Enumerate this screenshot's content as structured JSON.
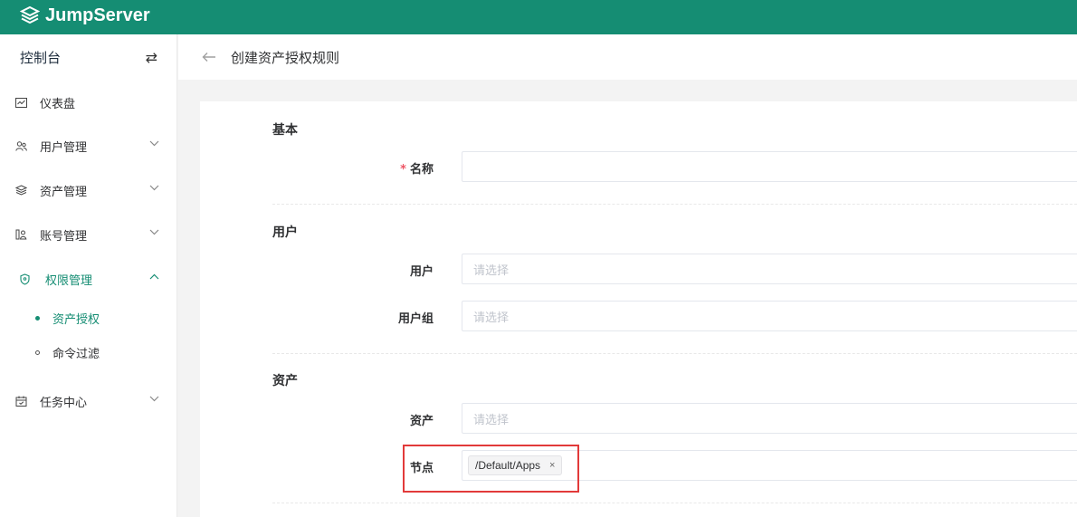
{
  "app": {
    "brand": "JumpServer"
  },
  "sidebar": {
    "title": "控制台",
    "items": [
      {
        "label": "仪表盘",
        "icon": "dashboard-icon"
      },
      {
        "label": "用户管理",
        "icon": "users-icon"
      },
      {
        "label": "资产管理",
        "icon": "layers-icon"
      },
      {
        "label": "账号管理",
        "icon": "accounts-icon"
      },
      {
        "label": "权限管理",
        "icon": "shield-icon"
      },
      {
        "label": "任务中心",
        "icon": "calendar-icon"
      }
    ],
    "subitems": [
      {
        "label": "资产授权"
      },
      {
        "label": "命令过滤"
      }
    ]
  },
  "page": {
    "title": "创建资产授权规则"
  },
  "form": {
    "basic": {
      "title": "基本",
      "name_label": "名称",
      "required_mark": "*"
    },
    "user": {
      "title": "用户",
      "user_label": "用户",
      "user_placeholder": "请选择",
      "group_label": "用户组",
      "group_placeholder": "请选择"
    },
    "asset": {
      "title": "资产",
      "asset_label": "资产",
      "asset_placeholder": "请选择",
      "node_label": "节点",
      "node_tag": "/Default/Apps",
      "tag_close": "×"
    }
  },
  "colors": {
    "brand": "#158d73",
    "active": "#158d73",
    "highlight": "#e23a3a",
    "required": "#ed5565"
  }
}
